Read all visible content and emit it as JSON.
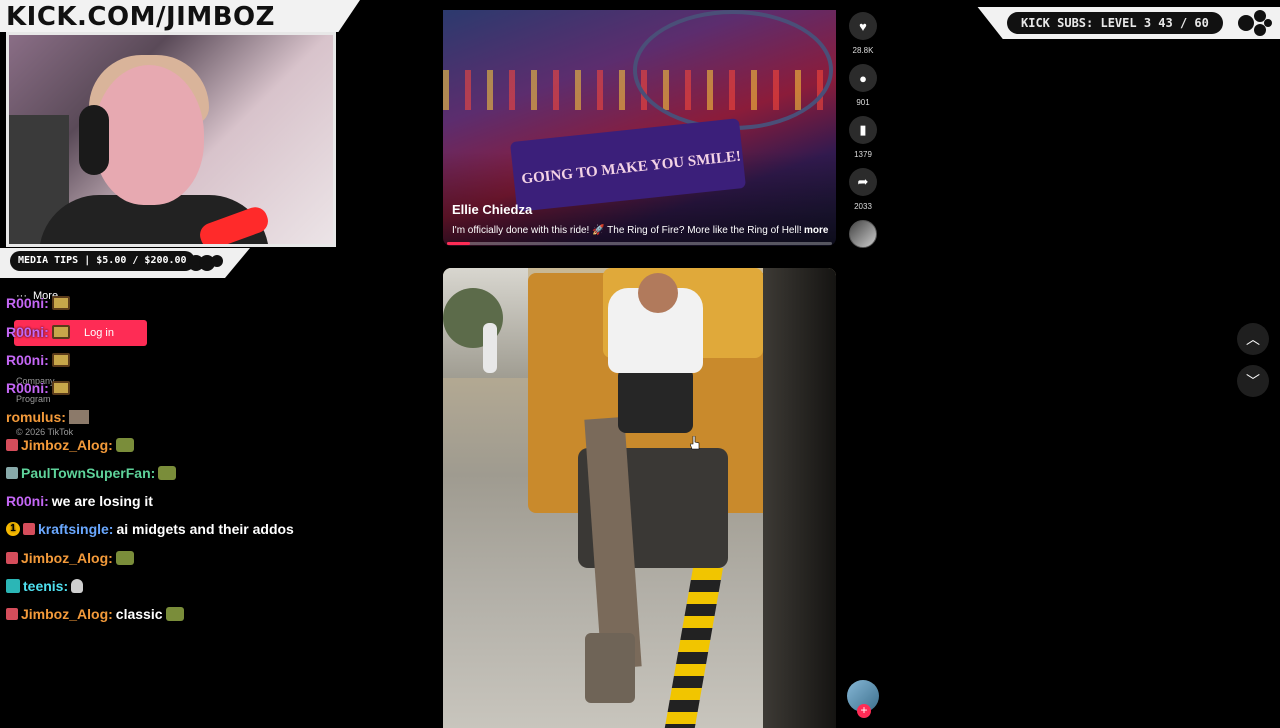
{
  "overlay": {
    "channel_title": "KICK.COM/JIMBOZ",
    "media_tips": "MEDIA TIPS | $5.00 / $200.00",
    "kick_subs": "KICK SUBS: LEVEL 3 43 / 60"
  },
  "tiktok_sidebar": {
    "more_label": "More",
    "login_label": "Log in",
    "company_label": "Company",
    "program_label": "Program",
    "copyright": "© 2026 TikTok"
  },
  "chat": [
    {
      "user": "R00ni:",
      "message": "",
      "color": "#c467f5"
    },
    {
      "user": "R00ni:",
      "message": "",
      "color": "#c467f5"
    },
    {
      "user": "R00ni:",
      "message": "",
      "color": "#c467f5"
    },
    {
      "user": "R00ni:",
      "message": "",
      "color": "#c467f5"
    },
    {
      "user": "romulus:",
      "message": "",
      "color": "#f39a3a"
    },
    {
      "user": "Jimboz_Alog:",
      "message": "",
      "color": "#f39a3a"
    },
    {
      "user": "PaulTownSuperFan:",
      "message": "",
      "color": "#5ed29a"
    },
    {
      "user": "R00ni:",
      "message": "we are losing it",
      "color": "#c467f5"
    },
    {
      "user": "kraftsingle:",
      "message": "ai midgets and their addos",
      "color": "#6aa8ff"
    },
    {
      "user": "Jimboz_Alog:",
      "message": "",
      "color": "#f39a3a"
    },
    {
      "user": "teenis:",
      "message": "",
      "color": "#4fe0f0"
    },
    {
      "user": "Jimboz_Alog:",
      "message": "classic",
      "color": "#f39a3a"
    }
  ],
  "video1": {
    "author": "Ellie Chiedza",
    "caption": "I'm officially done with this ride! 🚀 The Ring of Fire? More like the Ring of Hell!",
    "more_label": "more",
    "sign_text": "GOING TO MAKE YOU SMILE!",
    "progress": 0.06
  },
  "actions": {
    "likes": "28.8K",
    "comments": "901",
    "saves": "1379",
    "shares": "2033"
  },
  "colors": {
    "tiktok_red": "#fe2c55",
    "overlay_light": "#f2f2f2"
  }
}
